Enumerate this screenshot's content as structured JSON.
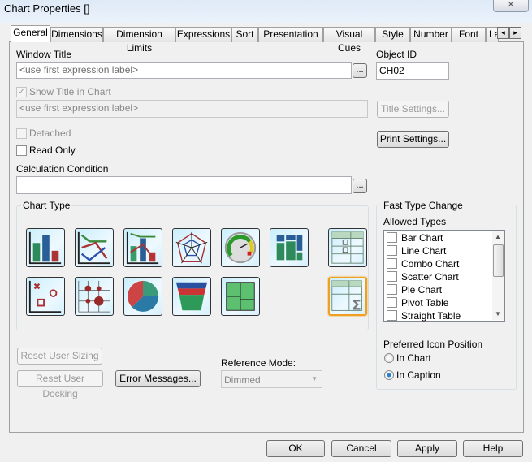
{
  "window": {
    "title": "Chart Properties []",
    "close_icon": "close-icon"
  },
  "tabs": [
    {
      "label": "General",
      "active": true
    },
    {
      "label": "Dimensions"
    },
    {
      "label": "Dimension Limits"
    },
    {
      "label": "Expressions"
    },
    {
      "label": "Sort"
    },
    {
      "label": "Presentation"
    },
    {
      "label": "Visual Cues"
    },
    {
      "label": "Style"
    },
    {
      "label": "Number"
    },
    {
      "label": "Font"
    },
    {
      "label": "La"
    }
  ],
  "tab_scroll": {
    "left": "◂",
    "right": "▸"
  },
  "general": {
    "window_title_label": "Window Title",
    "window_title_placeholder": "<use first expression label>",
    "object_id_label": "Object ID",
    "object_id_value": "CH02",
    "show_title_label": "Show Title in Chart",
    "show_title_checked": true,
    "chart_title_placeholder": "<use first expression label>",
    "title_settings": "Title Settings...",
    "detached_label": "Detached",
    "read_only_label": "Read Only",
    "print_settings": "Print Settings...",
    "calc_condition_label": "Calculation Condition",
    "calc_condition_value": "",
    "ellipsis": "...",
    "chart_type_label": "Chart Type",
    "chart_types": [
      "bar-chart",
      "line-chart",
      "combo-chart",
      "radar-chart",
      "gauge-chart",
      "mekko-chart",
      "pivot-table",
      "scatter-chart",
      "grid-chart",
      "pie-chart",
      "funnel-chart",
      "block-chart",
      "straight-table"
    ],
    "selected_chart_type": "straight-table",
    "reset_user_sizing": "Reset User Sizing",
    "reset_user_docking": "Reset User Docking",
    "error_messages": "Error Messages...",
    "reference_mode_label": "Reference Mode:",
    "reference_mode_value": "Dimmed",
    "fast_type_change_label": "Fast Type Change",
    "allowed_types_label": "Allowed Types",
    "allowed_types": [
      "Bar Chart",
      "Line Chart",
      "Combo Chart",
      "Scatter Chart",
      "Pie Chart",
      "Pivot Table",
      "Straight Table"
    ],
    "preferred_icon_position_label": "Preferred Icon Position",
    "in_chart_label": "In Chart",
    "in_caption_label": "In Caption",
    "preferred_icon_position": "In Caption"
  },
  "footer": {
    "ok": "OK",
    "cancel": "Cancel",
    "apply": "Apply",
    "help": "Help"
  }
}
